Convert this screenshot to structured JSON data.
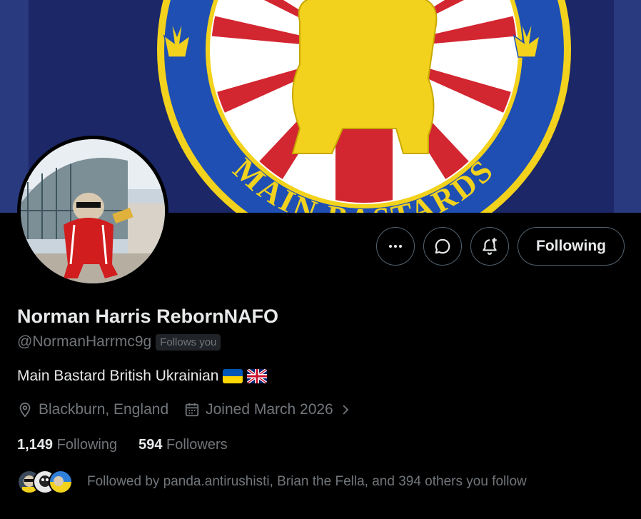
{
  "banner": {
    "emblem_text": "MAIN BASTARDS",
    "colors": {
      "navy": "#1d2a6b",
      "yellow": "#f2d21c",
      "red": "#d22630",
      "blue": "#1f4fb3"
    }
  },
  "profile": {
    "display_name": "Norman Harris RebornNAFO",
    "handle": "@NormanHarrmc9g",
    "follows_you_badge": "Follows you",
    "bio": "Main Bastard British Ukrainian",
    "bio_flags": [
      "ukraine-flag-emoji",
      "uk-flag-emoji"
    ]
  },
  "actions": {
    "more_icon": "ellipsis-icon",
    "message_icon": "chat-bubble-icon",
    "notify_icon": "bell-plus-icon",
    "follow_label": "Following"
  },
  "meta": {
    "location": "Blackburn, England",
    "joined": "Joined March 2026"
  },
  "stats": {
    "following_count": "1,149",
    "following_label": "Following",
    "followers_count": "594",
    "followers_label": "Followers"
  },
  "followed_by": {
    "text": "Followed by panda.antirushisti, Brian the Fella, and 394 others you follow"
  }
}
